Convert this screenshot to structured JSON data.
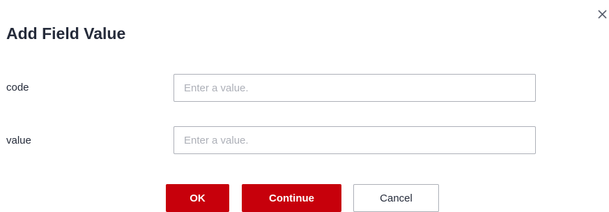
{
  "dialog": {
    "title": "Add Field Value",
    "close_icon": "close-icon"
  },
  "form": {
    "fields": [
      {
        "label": "code",
        "placeholder": "Enter a value.",
        "value": ""
      },
      {
        "label": "value",
        "placeholder": "Enter a value.",
        "value": ""
      }
    ]
  },
  "buttons": {
    "ok_label": "OK",
    "continue_label": "Continue",
    "cancel_label": "Cancel"
  },
  "colors": {
    "primary": "#c7000b",
    "border": "#adb0b8",
    "text": "#252b3a",
    "placeholder": "#adb0b8"
  }
}
